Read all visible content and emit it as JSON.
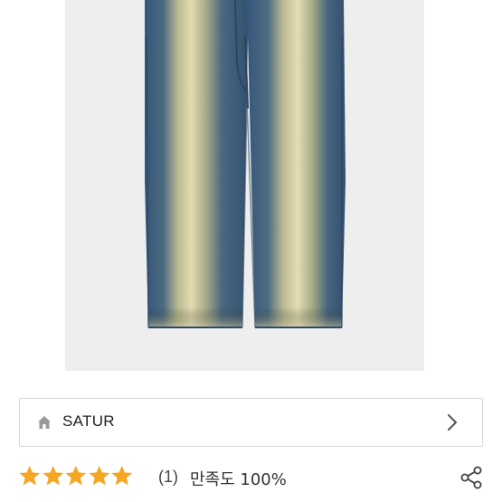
{
  "brand": {
    "name": "SATUR"
  },
  "rating": {
    "stars": 5,
    "max_stars": 5,
    "review_count": "(1)",
    "satisfaction": "만족도 100%",
    "star_color": "#F5A623"
  },
  "icons": {
    "home": "home-icon",
    "chevron": "chevron-right-icon",
    "share": "share-icon"
  },
  "colors": {
    "image_bg": "#eeeeee",
    "denim": "#3a5a78",
    "fade": "#d8d2a8"
  }
}
